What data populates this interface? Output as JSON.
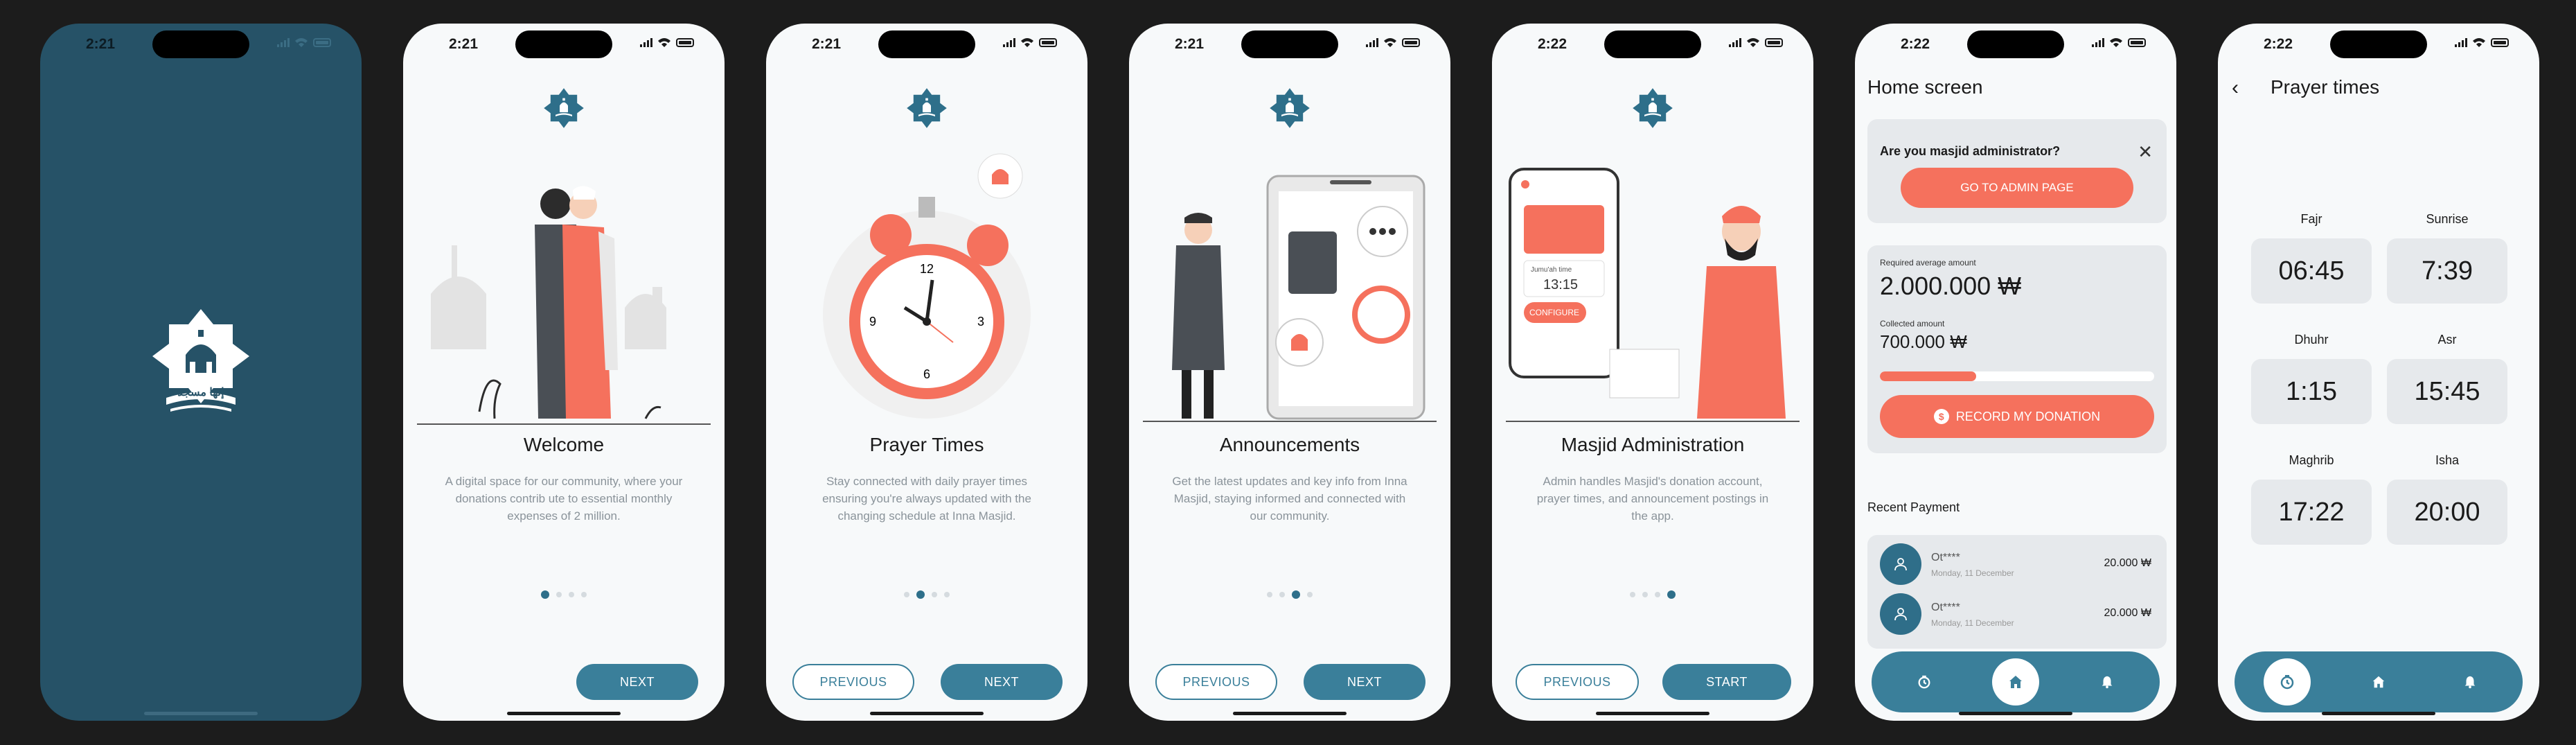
{
  "status_times": [
    "2:21",
    "2:21",
    "2:21",
    "2:21",
    "2:22",
    "2:22",
    "2:22"
  ],
  "splash": {
    "logo_text": "إنها مسجد"
  },
  "onboarding": [
    {
      "title": "Welcome",
      "description": "A digital space for our community, where your donations contrib ute to essential monthly expenses of 2 million.",
      "next": "NEXT"
    },
    {
      "title": "Prayer Times",
      "description": "Stay connected with daily prayer times ensuring you're always updated with the changing schedule at Inna Masjid.",
      "previous": "PREVIOUS",
      "next": "NEXT"
    },
    {
      "title": "Announcements",
      "description": "Get the latest updates and key info from Inna Masjid, staying informed and connected with our community.",
      "previous": "PREVIOUS",
      "next": "NEXT"
    },
    {
      "title": "Masjid Administration",
      "description": "Admin handles Masjid's donation account, prayer times, and announcement postings in the app.",
      "previous": "PREVIOUS",
      "next": "START"
    }
  ],
  "admin_illus": {
    "phone_time_label": "Jumu'ah time",
    "phone_time": "13:15",
    "phone_btn": "CONFIGURE"
  },
  "home": {
    "title": "Home screen",
    "admin_question": "Are you masjid administrator?",
    "admin_button": "GO TO ADMIN PAGE",
    "required_label": "Required average amount",
    "required_amount": "2.000.000 ₩",
    "collected_label": "Collected amount",
    "collected_amount": "700.000 ₩",
    "progress_percent": 35,
    "donate_button": "RECORD MY DONATION",
    "recent_title": "Recent Payment",
    "payments": [
      {
        "name": "Ot****",
        "date": "Monday, 11 December",
        "amount": "20.000 ₩"
      },
      {
        "name": "Ot****",
        "date": "Monday, 11 December",
        "amount": "20.000 ₩"
      }
    ]
  },
  "prayer": {
    "title": "Prayer times",
    "times": [
      {
        "name": "Fajr",
        "time": "06:45"
      },
      {
        "name": "Sunrise",
        "time": "7:39"
      },
      {
        "name": "Dhuhr",
        "time": "1:15"
      },
      {
        "name": "Asr",
        "time": "15:45"
      },
      {
        "name": "Maghrib",
        "time": "17:22"
      },
      {
        "name": "Isha",
        "time": "20:00"
      }
    ]
  },
  "colors": {
    "primary": "#3a7f9a",
    "accent": "#f5715d",
    "splash_bg": "#265267"
  }
}
